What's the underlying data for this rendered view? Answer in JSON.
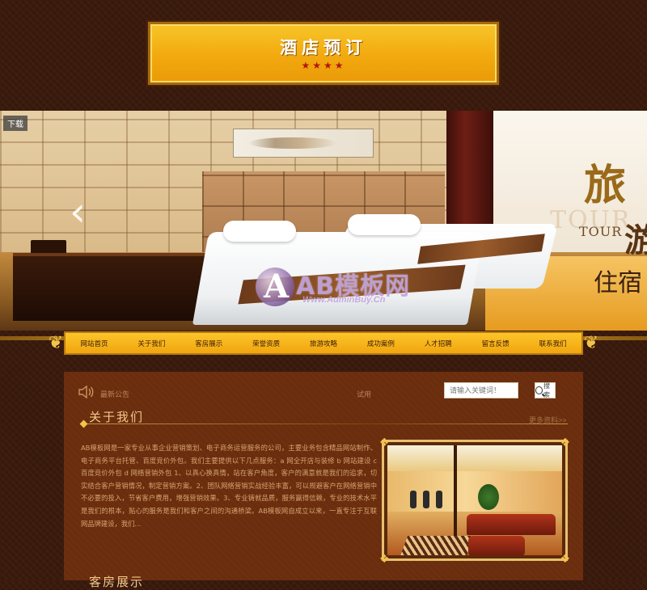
{
  "header": {
    "logo_title": "酒店预订",
    "logo_stars": "★★★★"
  },
  "banner": {
    "tag": "下载",
    "prev_arrow": "‹",
    "calligraphy_top": "旅",
    "tour_big": "TOUR",
    "tour_small": "TOUR",
    "calligraphy_mid": "游",
    "calligraphy_bottom": "住宿",
    "watermark": {
      "brand": "AB模板网",
      "url": "Www.AdminBuy.Cn"
    }
  },
  "nav": {
    "items": [
      "网站首页",
      "关于我们",
      "客房展示",
      "荣誉资质",
      "旅游攻略",
      "成功案例",
      "人才招聘",
      "留言反馈",
      "联系我们"
    ]
  },
  "notice": {
    "label": "最新公告",
    "text": "试用"
  },
  "search": {
    "placeholder": "请输入关键词！",
    "button_label": "搜索"
  },
  "about": {
    "title": "关于我们",
    "more": "更多资料>>",
    "body": "AB模板网是一家专业从事企业营销策划、电子商务运营服务的公司，主要业务包含精品网站制作、电子商务平台托管、百度竞价外包。我们主要提供以下几点服务：a 网全开店与装修 b 网站建设 c 百度竞价外包 d 网络营销外包 1、以真心换真情，站在客户角度，客户的满意就是我们的追求，切实结合客户营销情况，制定营销方案。2、团队网络营销实战经验丰富，可以规避客户在网络营销中不必要的投入，节省客户费用，增强营销效果。3、专业铸就品质，服务赢得信赖，专业的技术水平是我们的根本，贴心的服务是我们和客户之间的沟通桥梁。AB模板网自成立以来，一直专注于互联网品牌建设，我们..."
  },
  "next_section": {
    "title": "客房展示"
  },
  "colors": {
    "page_bg": "#3a1a0c",
    "gold": "#f3c34a",
    "nav_bg": "#f1a50f",
    "content_bg": "#6a2d0d",
    "body_text": "#d6a46f",
    "stars": "#b11611"
  }
}
